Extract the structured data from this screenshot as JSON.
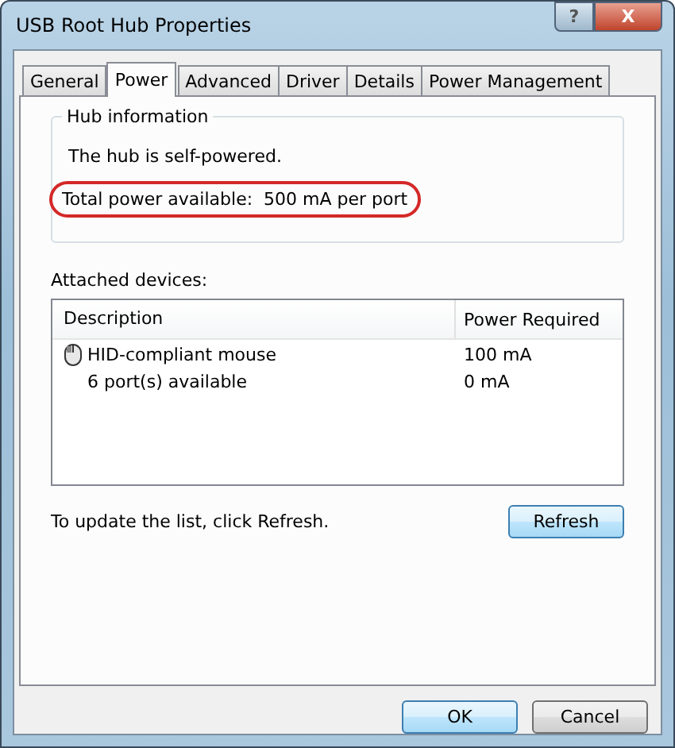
{
  "window": {
    "title": "USB Root Hub Properties",
    "help": "?",
    "close": "X"
  },
  "tabs": [
    {
      "label": "General",
      "selected": false
    },
    {
      "label": "Power",
      "selected": true
    },
    {
      "label": "Advanced",
      "selected": false
    },
    {
      "label": "Driver",
      "selected": false
    },
    {
      "label": "Details",
      "selected": false
    },
    {
      "label": "Power Management",
      "selected": false
    }
  ],
  "hub_information": {
    "title": "Hub information",
    "lines": [
      {
        "text": "The hub is self-powered.",
        "highlighted": false
      },
      {
        "text": "Total power available:  500 mA per port",
        "highlighted": true
      }
    ]
  },
  "attached_devices": {
    "label": "Attached devices:",
    "columns": [
      "Description",
      "Power Required"
    ],
    "rows": [
      {
        "description": "HID-compliant mouse",
        "power": "100 mA",
        "kind": "device"
      },
      {
        "description": "6 port(s) available",
        "power": "0 mA",
        "kind": "ports"
      }
    ]
  },
  "hint": "To update the list, click Refresh.",
  "refresh_button": "Refresh",
  "buttons": [
    {
      "label": "OK",
      "default": true
    },
    {
      "label": "Cancel",
      "default": false
    }
  ]
}
